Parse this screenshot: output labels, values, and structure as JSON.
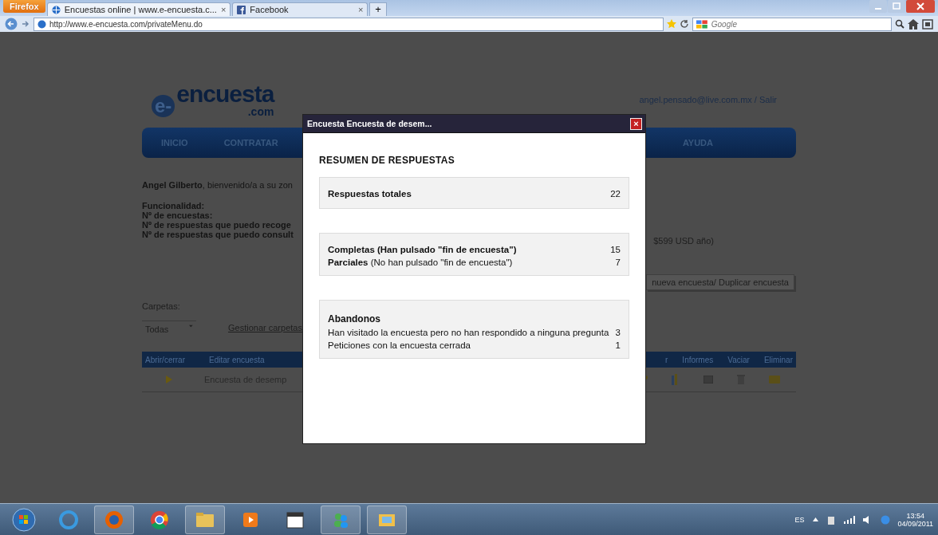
{
  "browser": {
    "menu_button": "Firefox",
    "tabs": [
      {
        "label": "Encuestas online | www.e-encuesta.c...",
        "close": "×",
        "selected": true
      },
      {
        "label": "Facebook",
        "close": "×",
        "selected": false
      }
    ],
    "new_tab": "+",
    "url": "http://www.e-encuesta.com/privateMenu.do",
    "search": {
      "placeholder": "Google"
    }
  },
  "site": {
    "logo": {
      "mark": "e-",
      "name": "encuesta",
      "domain": ".com"
    },
    "user": "angel.pensado@live.com.mx / Salir",
    "nav": [
      "INICIO",
      "CONTRATAR",
      "AYUDA"
    ],
    "welcome": "**Angel Gilberto**, bienvenido/a a su zon",
    "features": [
      "Funcionalidad:",
      "Nº de encuestas:",
      "Nº de respuestas que puedo recoge",
      "Nº de respuestas que puedo consult"
    ],
    "price": "$599 USD año)",
    "action_button": "nueva encuesta/ Duplicar encuesta",
    "folders_label": "Carpetas:",
    "folder_select": "Todas",
    "manage_link": "Gestionar carpetas",
    "table_columns_left": [
      "Abrir/cerrar",
      "Editar encuesta"
    ],
    "table_columns_right": [
      "r",
      "Informes",
      "Vaciar",
      "Eliminar"
    ],
    "row": "Encuesta de desemp"
  },
  "dialog": {
    "title": "Encuesta Encuesta de desem...",
    "close": "×",
    "heading": "RESUMEN DE RESPUESTAS",
    "sections": [
      {
        "rows": [
          {
            "label": "Respuestas totales",
            "value": "22",
            "bold": true
          }
        ]
      },
      {
        "rows": [
          {
            "label": "Completas (Han pulsado \"fin de encuesta\")",
            "value": "15",
            "bold": true
          },
          {
            "label": "**Parciales** (No han pulsado \"fin de encuesta\")",
            "value": "7",
            "bold": false
          }
        ]
      },
      {
        "title": "Abandonos",
        "rows": [
          {
            "label": "Han visitado la encuesta pero no han respondido a ninguna pregunta",
            "value": "3",
            "bold": false
          },
          {
            "label": "Peticiones con la encuesta cerrada",
            "value": "1",
            "bold": false
          }
        ]
      }
    ]
  },
  "taskbar": {
    "language": "ES",
    "time": "13:54",
    "date": "04/09/2011"
  }
}
